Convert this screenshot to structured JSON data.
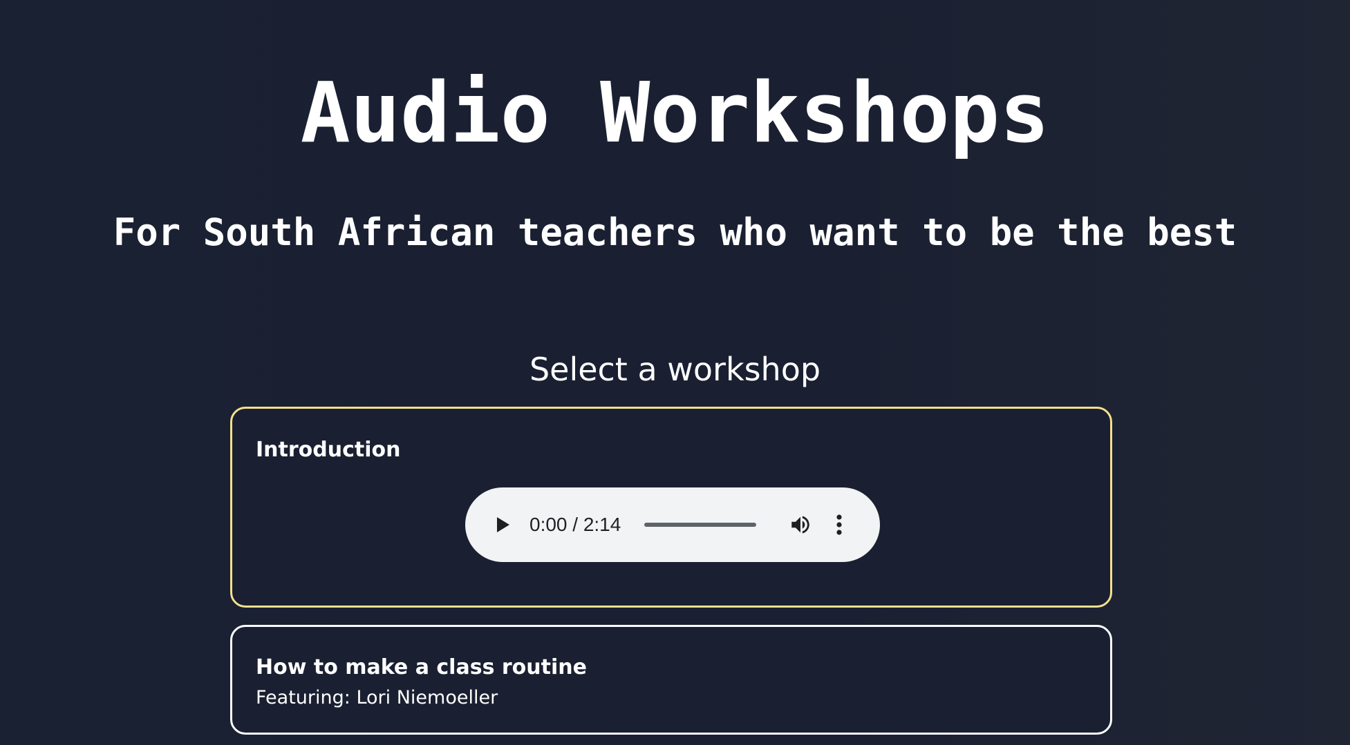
{
  "header": {
    "title": "Audio Workshops",
    "subtitle": "For South African teachers who want to be the best"
  },
  "workshops": {
    "heading": "Select a workshop",
    "items": [
      {
        "title": "Introduction",
        "selected": true,
        "player": {
          "time": "0:00 / 2:14",
          "progress": 0
        }
      },
      {
        "title": "How to make a class routine",
        "featuring": "Featuring: Lori Niemoeller",
        "selected": false
      }
    ]
  },
  "colors": {
    "background": "#1a2031",
    "text": "#ffffff",
    "selected_border": "#f5e08c",
    "card_border": "#ffffff",
    "player_background": "#f1f3f4"
  },
  "icons": {
    "play": "play-icon",
    "volume": "volume-icon",
    "more": "more-vertical-icon"
  }
}
